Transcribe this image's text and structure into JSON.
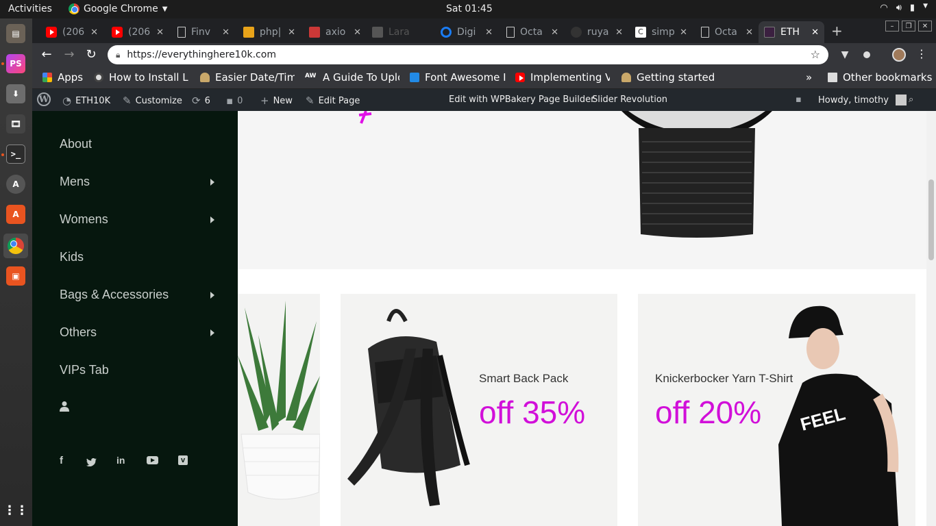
{
  "system": {
    "activities": "Activities",
    "app_name": "Google Chrome",
    "clock": "Sat 01:45"
  },
  "tabs": [
    {
      "title": "(206",
      "icon": "youtube-icon"
    },
    {
      "title": "(206",
      "icon": "youtube-icon"
    },
    {
      "title": "Finv",
      "icon": "document-icon"
    },
    {
      "title": "php|",
      "icon": "php-icon"
    },
    {
      "title": "axio",
      "icon": "npm-icon"
    },
    {
      "title": "Lara",
      "icon": "laravel-icon"
    },
    {
      "title": "Digi",
      "icon": "digitalocean-icon"
    },
    {
      "title": "Octa",
      "icon": "document-icon"
    },
    {
      "title": "ruya",
      "icon": "github-icon"
    },
    {
      "title": "simp",
      "icon": "c-icon"
    },
    {
      "title": "Octa",
      "icon": "document-icon"
    },
    {
      "title": "ETH",
      "icon": "site-icon",
      "active": true
    }
  ],
  "toolbar": {
    "url": "https://everythinghere10k.com"
  },
  "bookmarks": {
    "items": [
      {
        "label": "Apps",
        "icon": "apps-grid-icon"
      },
      {
        "label": "How to Install La",
        "icon": "globe-icon"
      },
      {
        "label": "Easier Date/Time",
        "icon": "bulb-icon"
      },
      {
        "label": "A Guide To Uploa",
        "icon": "aw-icon"
      },
      {
        "label": "Font Awesome Ic",
        "icon": "flag-icon"
      },
      {
        "label": "Implementing Vu",
        "icon": "youtube-icon"
      },
      {
        "label": "Getting started v",
        "icon": "bulb-icon"
      }
    ],
    "more": "»",
    "other": "Other bookmarks"
  },
  "wpbar": {
    "site": "ETH10K",
    "customize": "Customize",
    "updates": "6",
    "comments": "0",
    "new": "New",
    "edit_page": "Edit Page",
    "wpbakery": "Edit with WPBakery Page Builder",
    "slider": "Slider Revolution",
    "howdy": "Howdy, timothy"
  },
  "sidebar": {
    "items": [
      {
        "label": "About",
        "submenu": false
      },
      {
        "label": "Mens",
        "submenu": true
      },
      {
        "label": "Womens",
        "submenu": true
      },
      {
        "label": "Kids",
        "submenu": false
      },
      {
        "label": "Bags & Accessories",
        "submenu": true
      },
      {
        "label": "Others",
        "submenu": true
      },
      {
        "label": "VIPs Tab",
        "submenu": false
      }
    ],
    "social": [
      "f",
      "t",
      "in",
      "yt",
      "v"
    ]
  },
  "banners": [
    {
      "title": "Smart Back Pack",
      "offer": "off 35%"
    },
    {
      "title": "Knickerbocker Yarn T-Shirt",
      "offer": "off 20%"
    }
  ],
  "colors": {
    "accent": "#d10fd9",
    "sidebar_bg": "#06170e",
    "wpbar_bg": "#23282d"
  }
}
